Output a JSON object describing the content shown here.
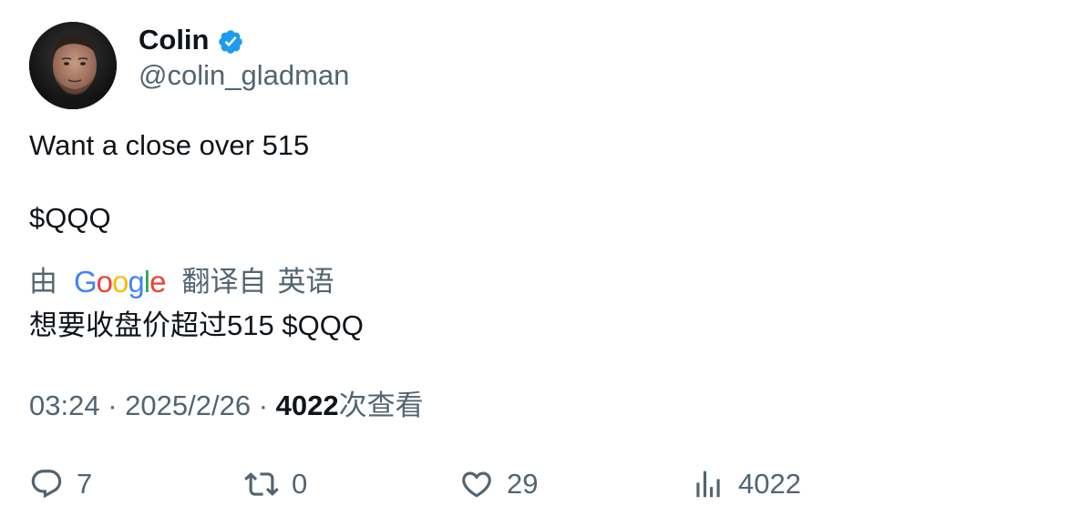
{
  "author": {
    "display_name": "Colin",
    "handle": "@colin_gladman",
    "verified_icon": "verified-badge-icon",
    "avatar_icon": "avatar-photo"
  },
  "tweet": {
    "line1": "Want a close over 515",
    "line2": "$QQQ"
  },
  "translation": {
    "prefix": "由",
    "provider": "Google",
    "suffix": "翻译自",
    "language": "英语",
    "text": "想要收盘价超过515 $QQQ"
  },
  "meta": {
    "time": "03:24",
    "separator": "·",
    "date": "2025/2/26",
    "views_count": "4022",
    "views_label": "次查看"
  },
  "actions": {
    "reply": {
      "icon": "reply-icon",
      "count": "7"
    },
    "retweet": {
      "icon": "retweet-icon",
      "count": "0"
    },
    "like": {
      "icon": "heart-icon",
      "count": "29"
    },
    "views": {
      "icon": "analytics-icon",
      "count": "4022"
    }
  },
  "colors": {
    "text_primary": "#0f1419",
    "text_secondary": "#536471",
    "verified_blue": "#1d9bf0",
    "google_blue": "#4285f4",
    "google_red": "#ea4335",
    "google_yellow": "#fbbc05",
    "google_green": "#34a853"
  }
}
